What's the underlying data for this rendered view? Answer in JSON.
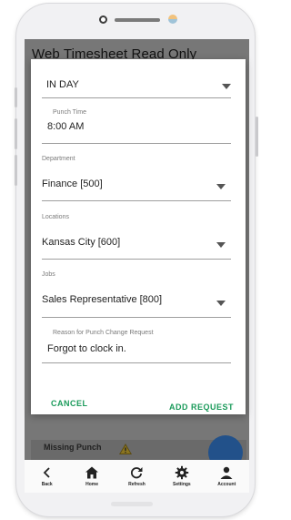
{
  "app": {
    "title": "Web Timesheet Read Only"
  },
  "form": {
    "punch_type": {
      "value": "IN DAY"
    },
    "punch_time": {
      "label": "Punch Time",
      "value": "8:00 AM"
    },
    "department": {
      "label": "Department",
      "value": "Finance [500]"
    },
    "location": {
      "label": "Locations",
      "value": "Kansas City [600]"
    },
    "job": {
      "label": "Jobs",
      "value": "Sales Representative [800]"
    },
    "reason": {
      "label": "Reason for Punch Change Request",
      "value": "Forgot to clock in."
    }
  },
  "actions": {
    "cancel": "CANCEL",
    "add_request": "ADD REQUEST"
  },
  "background": {
    "missing_punch": "Missing Punch"
  },
  "nav": [
    {
      "label": "Back",
      "icon": "back-icon"
    },
    {
      "label": "Home",
      "icon": "home-icon"
    },
    {
      "label": "Refresh",
      "icon": "refresh-icon"
    },
    {
      "label": "Settings",
      "icon": "settings-icon"
    },
    {
      "label": "Account",
      "icon": "account-icon"
    }
  ],
  "colors": {
    "accent": "#1a9a5a",
    "fab": "#22518a",
    "warning": "#f2c200"
  }
}
